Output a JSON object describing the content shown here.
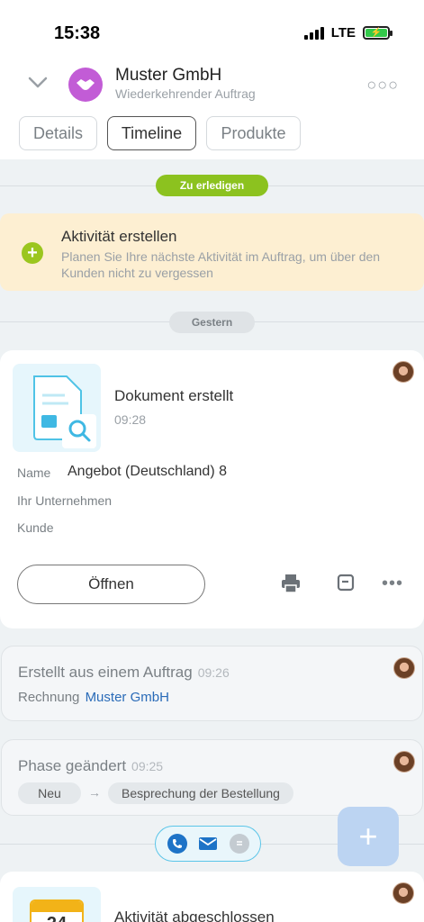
{
  "status": {
    "time": "15:38",
    "network": "LTE"
  },
  "header": {
    "company_name": "Muster GmbH",
    "subtitle": "Wiederkehrender Auftrag"
  },
  "tabs": [
    {
      "label": "Details",
      "active": false
    },
    {
      "label": "Timeline",
      "active": true
    },
    {
      "label": "Produkte",
      "active": false
    }
  ],
  "sections": {
    "todo_label": "Zu erledigen",
    "yesterday_label": "Gestern"
  },
  "create_activity": {
    "title": "Aktivität erstellen",
    "description": "Planen Sie Ihre nächste Aktivität im Auftrag, um über den Kunden nicht zu vergessen"
  },
  "document_card": {
    "title": "Dokument erstellt",
    "time": "09:28",
    "name_label": "Name",
    "name_value": "Angebot (Deutschland) 8",
    "company_label": "Ihr Unternehmen",
    "customer_label": "Kunde",
    "open_button": "Öffnen"
  },
  "created_from_card": {
    "title": "Erstellt aus einem Auftrag",
    "time": "09:26",
    "invoice_label": "Rechnung",
    "invoice_link": "Muster GmbH"
  },
  "phase_card": {
    "title": "Phase geändert",
    "time": "09:25",
    "from_phase": "Neu",
    "arrow": "→",
    "to_phase": "Besprechung der Bestellung"
  },
  "activity_done_card": {
    "title": "Aktivität abgeschlossen",
    "calendar_day": "24"
  },
  "fab": {
    "label": "+"
  },
  "colors": {
    "accent_green": "#9bc61f",
    "link_blue": "#2a6bb8",
    "create_bg": "#fdefd2",
    "avatar_purple": "#c25cd6"
  },
  "icons": [
    "chevron-down-icon",
    "handshake-icon",
    "more-icon",
    "plus-icon",
    "document-icon",
    "print-icon",
    "note-icon",
    "phone-icon",
    "mail-icon",
    "chat-icon",
    "calendar-icon"
  ]
}
